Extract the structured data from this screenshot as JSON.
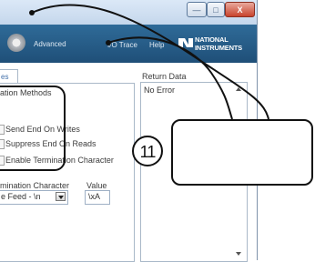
{
  "window": {
    "buttons": {
      "minimize": "—",
      "maximize": "□",
      "close": "X"
    }
  },
  "toolbar": {
    "icon": "gear-icon",
    "advanced_label": "Advanced",
    "trace_label": "I/O Trace",
    "help_label": "Help",
    "logo_line1": "NATIONAL",
    "logo_line2": "INSTRUMENTS",
    "logo_icon": "eagle-logo-icon"
  },
  "left_panel": {
    "tab_label": "es",
    "group_label": "ation Methods",
    "options": [
      {
        "label": "Send End On Writes"
      },
      {
        "label": "Suppress End On Reads"
      },
      {
        "label": "Enable Termination Character"
      }
    ],
    "termination_char_label": "mination Character",
    "termination_char_value": "e Feed - \\n",
    "value_label": "Value",
    "value_field": "\\xA"
  },
  "return_data": {
    "label": "Return Data",
    "text": "No Error"
  },
  "callout": {
    "number": "11"
  },
  "colors": {
    "toolbar_bg": "#1f4f78",
    "titlebar_bg": "#c5d7ec",
    "link_blue": "#3f6ea8"
  }
}
